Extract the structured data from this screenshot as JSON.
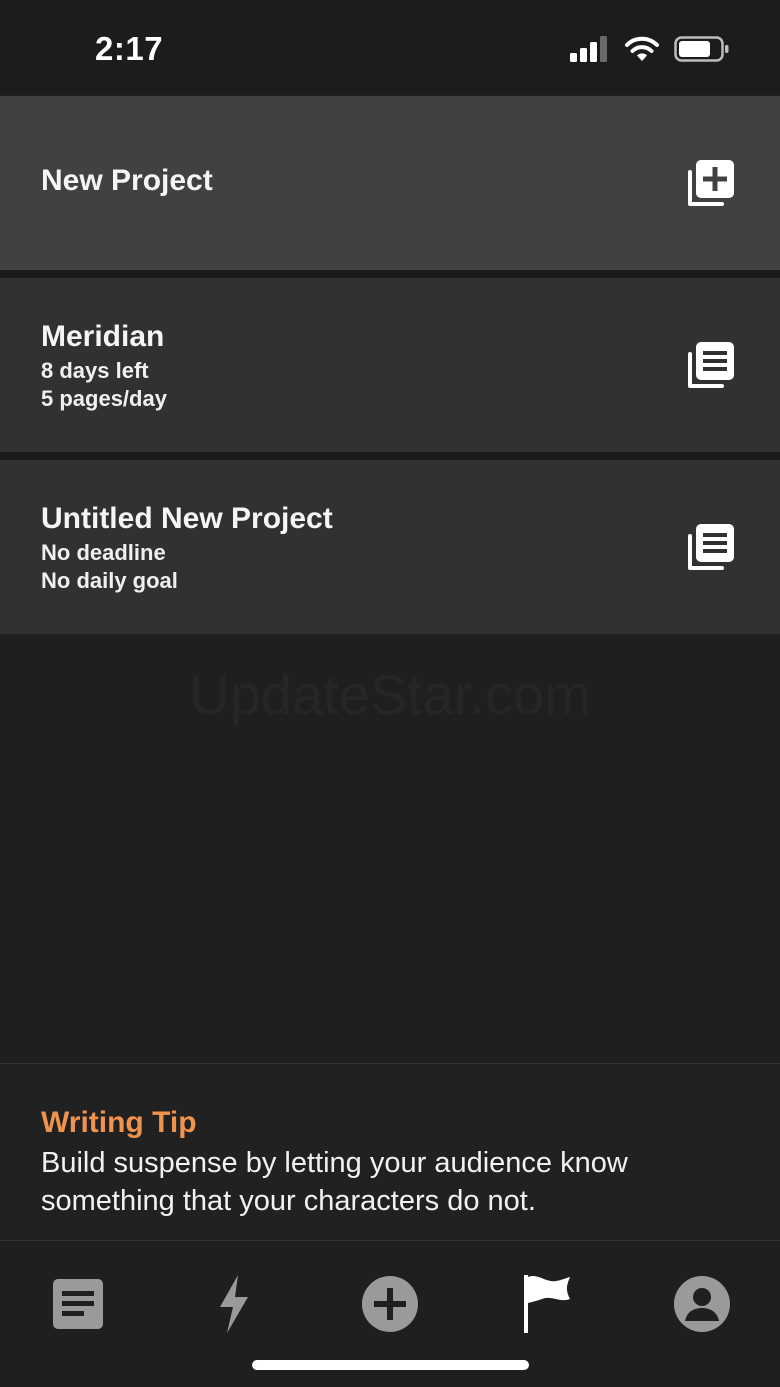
{
  "status_bar": {
    "time": "2:17",
    "icons": [
      "cellular-signal-icon",
      "wifi-icon",
      "battery-icon"
    ]
  },
  "new_project": {
    "label": "New Project",
    "icon": "add-project-icon"
  },
  "projects": [
    {
      "title": "Meridian",
      "deadline": "8 days left",
      "goal": "5 pages/day",
      "icon": "document-stack-icon"
    },
    {
      "title": "Untitled New Project",
      "deadline": "No deadline",
      "goal": "No daily goal",
      "icon": "document-stack-icon"
    }
  ],
  "watermark": "UpdateStar.com",
  "writing_tip": {
    "title": "Writing Tip",
    "body": "Build suspense by letting your audience know something that your characters do not."
  },
  "tab_bar": {
    "tabs": [
      {
        "icon": "document-icon"
      },
      {
        "icon": "lightning-icon"
      },
      {
        "icon": "add-circle-icon"
      },
      {
        "icon": "flag-icon"
      },
      {
        "icon": "profile-icon"
      }
    ]
  },
  "colors": {
    "accent": "#f0934d",
    "card_new_bg": "#414141",
    "card_project_bg": "#313131",
    "background": "#1f1f1f",
    "icon_gray": "#9a9a9a"
  }
}
